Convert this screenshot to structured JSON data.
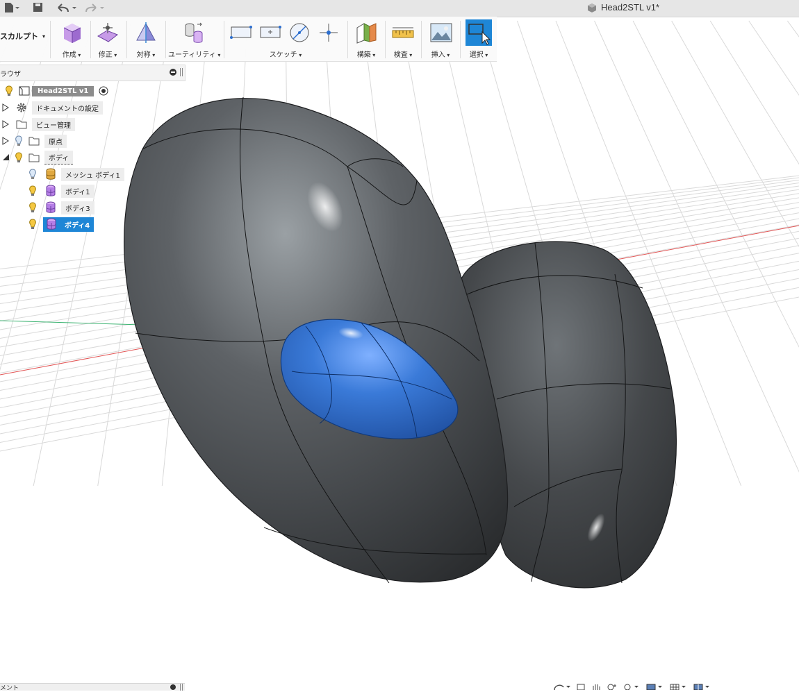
{
  "window": {
    "document_title": "Head2STL v1*"
  },
  "toolbar": {
    "workspace": "スカルプト",
    "groups": [
      {
        "key": "create",
        "label": "作成"
      },
      {
        "key": "modify",
        "label": "修正"
      },
      {
        "key": "symmetry",
        "label": "対称"
      },
      {
        "key": "utilities",
        "label": "ユーティリティ"
      },
      {
        "key": "sketch",
        "label": "スケッチ"
      },
      {
        "key": "construct",
        "label": "構築"
      },
      {
        "key": "inspect",
        "label": "検査"
      },
      {
        "key": "insert",
        "label": "挿入"
      },
      {
        "key": "select",
        "label": "選択"
      }
    ]
  },
  "browser": {
    "title": "ラウザ",
    "root": {
      "label": "Head2STL v1"
    },
    "items": [
      {
        "label": "ドキュメントの設定",
        "icon": "gear-icon"
      },
      {
        "label": "ビュー管理",
        "icon": "folder-icon"
      },
      {
        "label": "原点",
        "icon": "folder-icon"
      },
      {
        "label": "ボディ",
        "icon": "folder-icon"
      },
      {
        "label": "メッシュ ボディ1",
        "icon": "mesh-body-icon"
      },
      {
        "label": "ボディ1",
        "icon": "tspline-body-icon"
      },
      {
        "label": "ボディ3",
        "icon": "tspline-body-icon"
      },
      {
        "label": "ボディ4",
        "icon": "tspline-body-icon",
        "selected": true
      }
    ]
  },
  "comments": {
    "title": "メント"
  },
  "colors": {
    "accent": "#1e86d6",
    "body_gray": "#4a4c4f",
    "body_selected": "#2f6fd0"
  }
}
